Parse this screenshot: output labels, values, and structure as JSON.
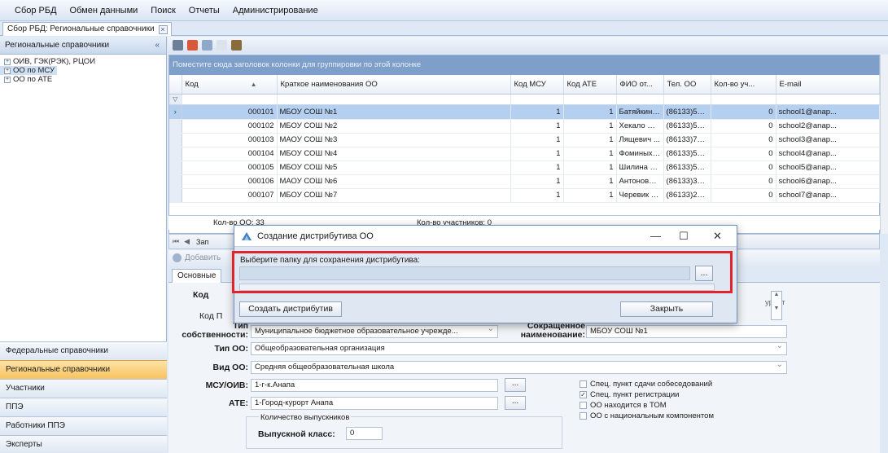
{
  "menu": [
    "Сбор РБД",
    "Обмен данными",
    "Поиск",
    "Отчеты",
    "Администрирование"
  ],
  "doc_tab": {
    "label": "Сбор РБД: Региональные справочники",
    "close": "×"
  },
  "left_panel": {
    "title": "Региональные справочники",
    "collapse": "«",
    "tree": [
      {
        "label": "ОИВ, ГЭК(РЭК), РЦОИ",
        "selected": false
      },
      {
        "label": "ОО по МСУ",
        "selected": true
      },
      {
        "label": "ОО по АТЕ",
        "selected": false
      }
    ],
    "nav": [
      {
        "label": "Федеральные справочники",
        "active": false
      },
      {
        "label": "Региональные справочники",
        "active": true
      },
      {
        "label": "Участники",
        "active": false
      },
      {
        "label": "ППЭ",
        "active": false
      },
      {
        "label": "Работники ППЭ",
        "active": false
      },
      {
        "label": "Эксперты",
        "active": false
      }
    ]
  },
  "grid": {
    "group_hint": "Поместите сюда заголовок колонки для группировки по этой колонке",
    "columns": [
      "Код",
      "Краткое наименования ОО",
      "Код МСУ",
      "Код АТЕ",
      "ФИО от...",
      "Тел. ОО",
      "Кол-во уч...",
      "E-mail"
    ],
    "sort_indicator": "▲",
    "rows": [
      [
        "000101",
        "МБОУ СОШ №1",
        "1",
        "1",
        "Батяйкина...",
        "(86133)56...",
        "0",
        "school1@anap..."
      ],
      [
        "000102",
        "МБОУ СОШ №2",
        "1",
        "1",
        "Хекало На...",
        "(86133)54...",
        "0",
        "school2@anap..."
      ],
      [
        "000103",
        "МАОУ СОШ №3",
        "1",
        "1",
        "Лящевич ...",
        "(86133)73...",
        "0",
        "school3@anap..."
      ],
      [
        "000104",
        "МБОУ СОШ №4",
        "1",
        "1",
        "Фоминых ...",
        "(86133)50...",
        "0",
        "school4@anap..."
      ],
      [
        "000105",
        "МБОУ СОШ №5",
        "1",
        "1",
        "Шилина Н...",
        "(86133)50...",
        "0",
        "school5@anap..."
      ],
      [
        "000106",
        "МАОУ СОШ №6",
        "1",
        "1",
        "Антонова ...",
        "(86133)35...",
        "0",
        "school6@anap..."
      ],
      [
        "000107",
        "МБОУ СОШ №7",
        "1",
        "1",
        "Черевик Т...",
        "(86133)27...",
        "0",
        "school7@anap..."
      ]
    ],
    "footer_count": "Кол-во ОО: 33",
    "footer_participants": "Кол-во участников: 0",
    "pager_text": "Зап"
  },
  "form": {
    "add_label": "Добавить",
    "tab": "Основные",
    "kod_label": "Код",
    "kodp_label": "Код П",
    "tip_label": "Тип собственности:",
    "tip_value": "Муниципальное бюджетное образовательное учрежде...",
    "short_label": "Сокращенное наименование:",
    "short_value": "МБОУ СОШ №1",
    "type_label": "Тип ОО:",
    "type_value": "Общеобразовательная организация",
    "kind_label": "Вид ОО:",
    "kind_value": "Средняя общеобразовательная школа",
    "msu_label": "МСУ/ОИВ:",
    "msu_value": "1-г-к.Анапа",
    "ate_label": "АТЕ:",
    "ate_value": "1-Город-курорт Анапа",
    "ellipsis": "...",
    "grads_group": "Количество выпускников",
    "grad_label": "Выпускной класс:",
    "grad_value": "0",
    "right_snippet": "урорт",
    "checkboxes": [
      {
        "label": "Спец. пункт сдачи собеседований",
        "checked": false
      },
      {
        "label": "Спец. пункт регистрации",
        "checked": true
      },
      {
        "label": "ОО находится в ТОМ",
        "checked": false
      },
      {
        "label": "ОО с национальным компонентом",
        "checked": false
      }
    ]
  },
  "dialog": {
    "title": "Создание дистрибутива ОО",
    "minimize": "—",
    "maximize": "☐",
    "close": "✕",
    "folder_label": "Выберите папку для сохранения дистрибутива:",
    "browse": "...",
    "create_button": "Создать дистрибутив",
    "close_button": "Закрыть"
  }
}
